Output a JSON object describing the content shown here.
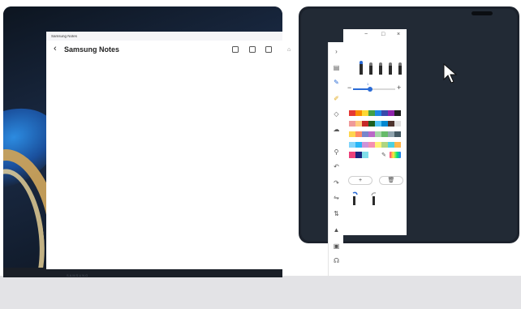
{
  "left_window": {
    "titlebar": "Samsung Notes",
    "title": "Samsung Notes",
    "brand": "SAMSUNG",
    "icons": [
      "book-icon",
      "pdf-icon",
      "edit-icon"
    ]
  },
  "pen_panel": {
    "window_controls": [
      "−",
      "□",
      "×"
    ],
    "size_value": "1",
    "add_label": "+",
    "colors": {
      "row1": [
        "#e53935",
        "#fb8c00",
        "#fdd835",
        "#43a047",
        "#1e88e5",
        "#3949ab",
        "#8e24aa",
        "#212121"
      ],
      "row2": [
        "#ef9a9a",
        "#ffcc80",
        "#c62828",
        "#1b5e20",
        "#4fc3f7",
        "#0288d1",
        "#4e342e",
        "#e0e0e0"
      ],
      "row3": [
        "#ffd54f",
        "#ff8a65",
        "#7986cb",
        "#ba68c8",
        "#a5d6a7",
        "#66bb6a",
        "#90a4ae",
        "#455a64"
      ],
      "row4": [
        "#81d4fa",
        "#29b6f6",
        "#ce93d8",
        "#f48fb1",
        "#fff176",
        "#aed581",
        "#4dd0e1",
        "#ffb74d"
      ],
      "row5": [
        "#ec407a",
        "#1a237e",
        "#80deea"
      ]
    }
  },
  "toolbar": {
    "tools": [
      "chevron-right-icon",
      "keyboard-icon",
      "pen-icon",
      "highlighter-icon",
      "eraser-icon",
      "lasso-icon",
      "shape-icon",
      "undo-icon",
      "redo-icon",
      "text-icon",
      "format-icon",
      "fill-icon",
      "image-icon",
      "audio-icon"
    ]
  }
}
